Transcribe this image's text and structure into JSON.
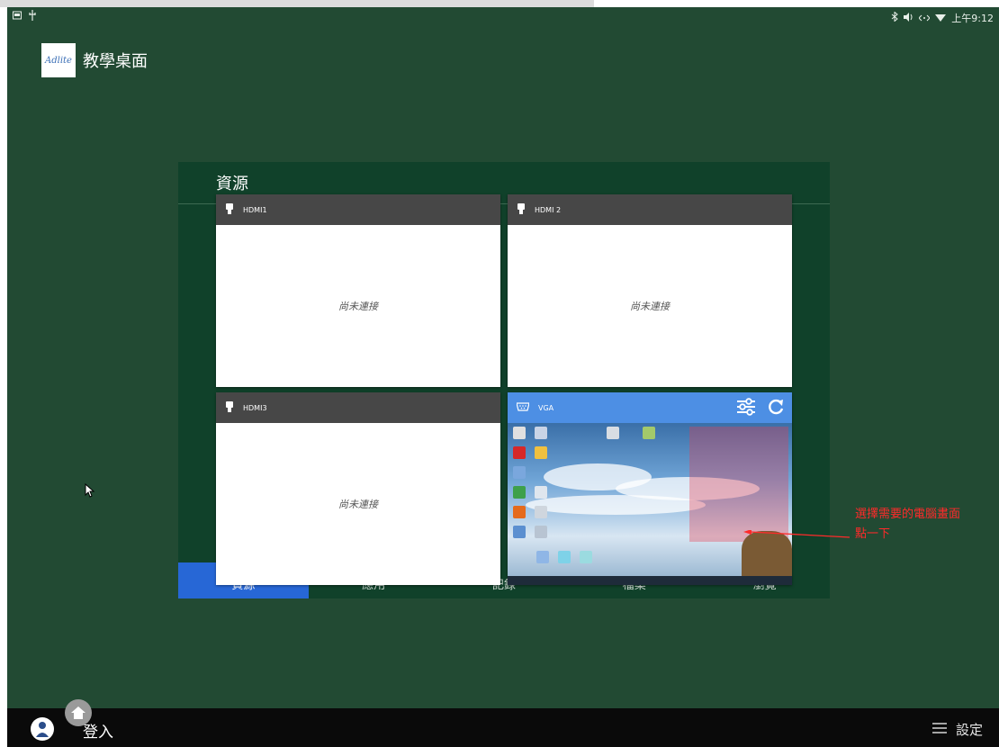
{
  "status_bar": {
    "left_icons": [
      "gallery-icon",
      "usb-icon"
    ],
    "right_icons": [
      "bluetooth-icon",
      "volume-icon",
      "ethernet-icon",
      "wifi-icon"
    ],
    "time": "上午9:12"
  },
  "desktop": {
    "logo_text": "Adlite",
    "title": "教學桌面"
  },
  "panel": {
    "title": "資源",
    "bottom_tabs": [
      {
        "label": "資源",
        "active": true
      },
      {
        "label": "應用",
        "active": false
      },
      {
        "label": "記錄",
        "active": false
      },
      {
        "label": "檔案",
        "active": false
      },
      {
        "label": "瀏覽",
        "active": false
      }
    ]
  },
  "sources": [
    {
      "name": "HDMI1",
      "icon": "hdmi-plug-icon",
      "status": "尚未連接"
    },
    {
      "name": "HDMI 2",
      "icon": "hdmi-plug-icon",
      "status": "尚未連接"
    },
    {
      "name": "HDMI3",
      "icon": "hdmi-plug-icon",
      "status": "尚未連接"
    },
    {
      "name": "VGA",
      "icon": "vga-port-icon",
      "status": "",
      "actions": [
        "settings-sliders-icon",
        "refresh-icon"
      ]
    }
  ],
  "annotation": {
    "line1": "選擇需要的電腦畫面",
    "line2": "點一下",
    "color": "#ff2a2a"
  },
  "bottom_bar": {
    "login_label": "登入",
    "settings_label": "設定"
  },
  "colors": {
    "desktop_bg": "#224a33",
    "panel_bg": "#10412a",
    "active_tab": "#2767d6",
    "vga_header": "#4d8fe4",
    "hdmi_header": "#474747"
  }
}
